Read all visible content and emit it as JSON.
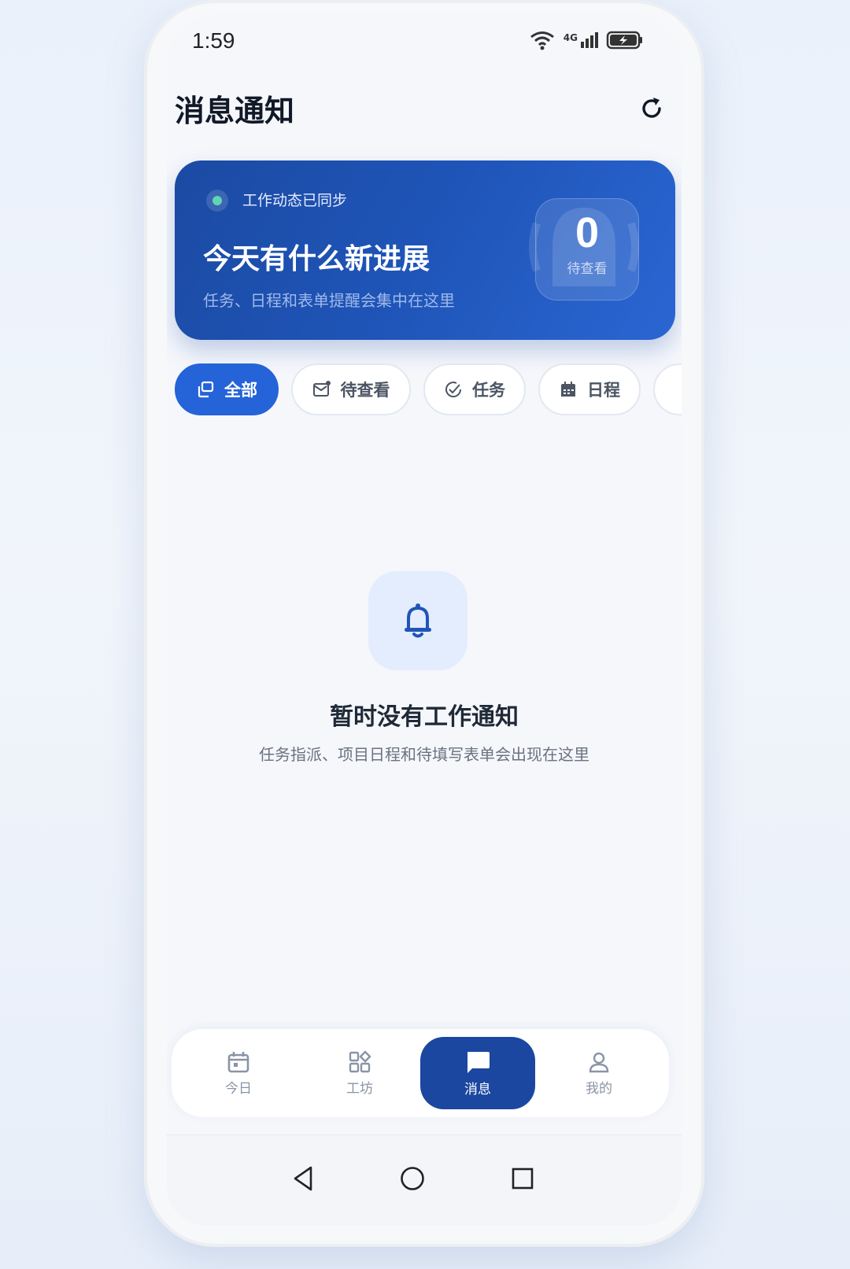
{
  "status_bar": {
    "time": "1:59",
    "icons": [
      "wifi-icon",
      "signal-4g-icon",
      "battery-charging-icon"
    ],
    "network": "4G"
  },
  "header": {
    "title": "消息通知",
    "refresh_icon": "refresh-icon"
  },
  "hero": {
    "sync_text": "工作动态已同步",
    "headline": "今天有什么新进展",
    "subtitle": "任务、日程和表单提醒会集中在这里",
    "count": "0",
    "count_label": "待查看",
    "accent": "#1f55b8",
    "sync_dot_color": "#5fd6b0"
  },
  "filters": [
    {
      "label": "全部",
      "icon": "stack-icon",
      "active": true
    },
    {
      "label": "待查看",
      "icon": "mail-icon",
      "active": false
    },
    {
      "label": "任务",
      "icon": "check-circle-icon",
      "active": false
    },
    {
      "label": "日程",
      "icon": "calendar-icon",
      "active": false
    }
  ],
  "empty_state": {
    "icon": "bell-icon",
    "title": "暂时没有工作通知",
    "subtitle": "任务指派、项目日程和待填写表单会出现在这里"
  },
  "tabbar": [
    {
      "label": "今日",
      "icon": "calendar-icon",
      "active": false
    },
    {
      "label": "工坊",
      "icon": "grid-icon",
      "active": false
    },
    {
      "label": "消息",
      "icon": "chat-icon",
      "active": true
    },
    {
      "label": "我的",
      "icon": "person-icon",
      "active": false
    }
  ],
  "system_nav": [
    "back-icon",
    "home-icon",
    "recents-icon"
  ]
}
